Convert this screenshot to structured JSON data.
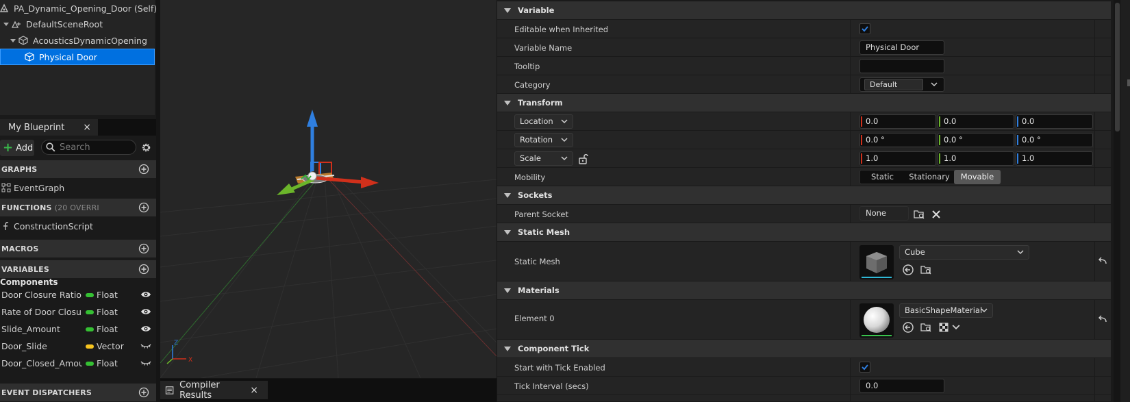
{
  "components_tree": {
    "self": "PA_Dynamic_Opening_Door (Self)",
    "root": "DefaultSceneRoot",
    "opening": "AcousticsDynamicOpening",
    "selected": "Physical Door"
  },
  "my_blueprint": {
    "tab_label": "My Blueprint",
    "close": "×",
    "add_label": "Add",
    "search_placeholder": "Search",
    "graphs_header": "GRAPHS",
    "event_graph": "EventGraph",
    "functions_header": "FUNCTIONS",
    "functions_sub": "(20 OVERRI",
    "construction_script": "ConstructionScript",
    "macros_header": "MACROS",
    "variables_header": "VARIABLES",
    "components_label": "Components",
    "variables": [
      {
        "name": "Door Closure Ratio",
        "type": "Float",
        "color": "#35c033",
        "visible": true
      },
      {
        "name": "Rate of Door Closure",
        "type": "Float",
        "color": "#35c033",
        "visible": true
      },
      {
        "name": "Slide_Amount",
        "type": "Float",
        "color": "#35c033",
        "visible": true
      },
      {
        "name": "Door_Slide",
        "type": "Vector",
        "color": "#f7c41f",
        "visible": false
      },
      {
        "name": "Door_Closed_Amoun",
        "type": "Float",
        "color": "#35c033",
        "visible": false
      }
    ],
    "event_dispatchers_header": "EVENT DISPATCHERS"
  },
  "bottom_tabs": {
    "compiler_results": "Compiler Results",
    "close": "×"
  },
  "details": {
    "variable_section": "Variable",
    "editable_label": "Editable when Inherited",
    "editable_checked": true,
    "variable_name_label": "Variable Name",
    "variable_name_value": "Physical Door",
    "tooltip_label": "Tooltip",
    "tooltip_value": "",
    "category_label": "Category",
    "category_value": "Default",
    "transform_section": "Transform",
    "location_label": "Location",
    "location": [
      "0.0",
      "0.0",
      "0.0"
    ],
    "rotation_label": "Rotation",
    "rotation": [
      "0.0 °",
      "0.0 °",
      "0.0 °"
    ],
    "scale_label": "Scale",
    "scale": [
      "1.0",
      "1.0",
      "1.0"
    ],
    "mobility_label": "Mobility",
    "mobility_options": [
      "Static",
      "Stationary",
      "Movable"
    ],
    "mobility_selected": "Movable",
    "sockets_section": "Sockets",
    "parent_socket_label": "Parent Socket",
    "parent_socket_value": "None",
    "static_mesh_section": "Static Mesh",
    "static_mesh_label": "Static Mesh",
    "static_mesh_value": "Cube",
    "materials_section": "Materials",
    "element0_label": "Element 0",
    "element0_value": "BasicShapeMaterial",
    "component_tick_section": "Component Tick",
    "start_tick_label": "Start with Tick Enabled",
    "start_tick_checked": true,
    "tick_interval_label": "Tick Interval (secs)",
    "tick_interval_value": "0.0"
  },
  "colors": {
    "selection": "#0070e0",
    "axis_x": "#d0301b",
    "axis_y": "#6bb52a",
    "axis_z": "#2f7fe0",
    "checkbox_accent": "#2f7fe0"
  }
}
